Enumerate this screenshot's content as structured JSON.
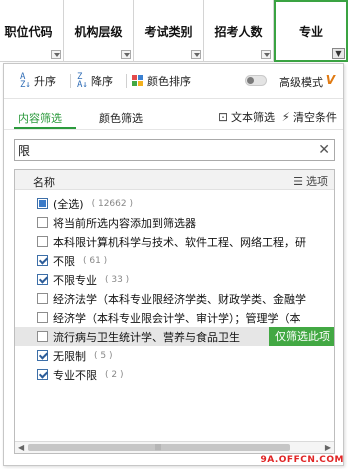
{
  "columns": [
    {
      "label": "职位代码"
    },
    {
      "label": "机构层级"
    },
    {
      "label": "考试类别"
    },
    {
      "label": "招考人数"
    },
    {
      "label": "专业"
    }
  ],
  "sort": {
    "asc": "升序",
    "desc": "降序",
    "color": "颜色排序",
    "advanced_label": "高级模式",
    "advanced_badge": "V"
  },
  "tabs": {
    "content": "内容筛选",
    "color": "颜色筛选",
    "text_filter": "文本筛选",
    "clear": "清空条件"
  },
  "search": {
    "value": "限"
  },
  "list": {
    "header_name": "名称",
    "header_options": "选项",
    "items": [
      {
        "label": "(全选)",
        "count": "( 12662 )",
        "state": "partial"
      },
      {
        "label": "将当前所选内容添加到筛选器",
        "count": "",
        "state": "unchecked"
      },
      {
        "label": "本科限计算机科学与技术、软件工程、网络工程，研",
        "count": "",
        "state": "unchecked"
      },
      {
        "label": "不限",
        "count": "( 61 )",
        "state": "checked"
      },
      {
        "label": "不限专业",
        "count": "( 33 )",
        "state": "checked"
      },
      {
        "label": "经济法学（本科专业限经济学类、财政学类、金融学",
        "count": "",
        "state": "unchecked"
      },
      {
        "label": "经济学（本科专业限会计学、审计学）；管理学（本",
        "count": "",
        "state": "unchecked"
      },
      {
        "label": "流行病与卫生统计学、营养与食品卫生",
        "count": "",
        "state": "unchecked"
      },
      {
        "label": "无限制",
        "count": "( 5 )",
        "state": "checked"
      },
      {
        "label": "专业不限",
        "count": "( 2 )",
        "state": "checked"
      }
    ],
    "hover_tip": "仅筛选此项"
  },
  "watermark": "9A.OFFCN.COM"
}
